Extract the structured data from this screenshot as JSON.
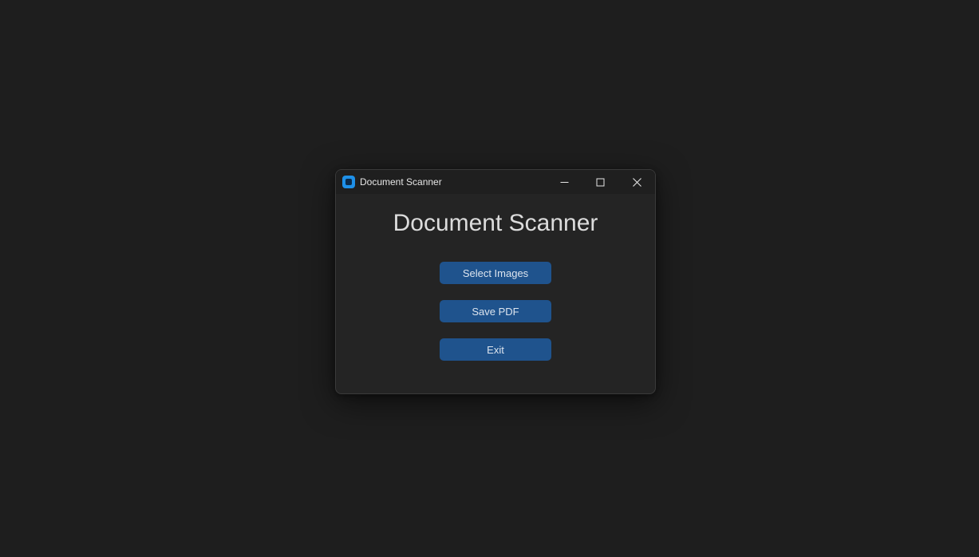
{
  "window": {
    "title": "Document Scanner",
    "app_icon": "app-icon"
  },
  "controls": {
    "minimize_icon": "minimize-icon",
    "maximize_icon": "maximize-icon",
    "close_icon": "close-icon"
  },
  "main": {
    "heading": "Document Scanner",
    "buttons": [
      {
        "label": "Select Images"
      },
      {
        "label": "Save PDF"
      },
      {
        "label": "Exit"
      }
    ]
  },
  "colors": {
    "background": "#1e1e1e",
    "window_bg": "#242424",
    "titlebar_bg": "#1f1f1f",
    "button_bg": "#1f538d",
    "button_text": "#dce4ee",
    "heading_text": "#dcdcdc",
    "app_icon": "#1e90e8"
  }
}
